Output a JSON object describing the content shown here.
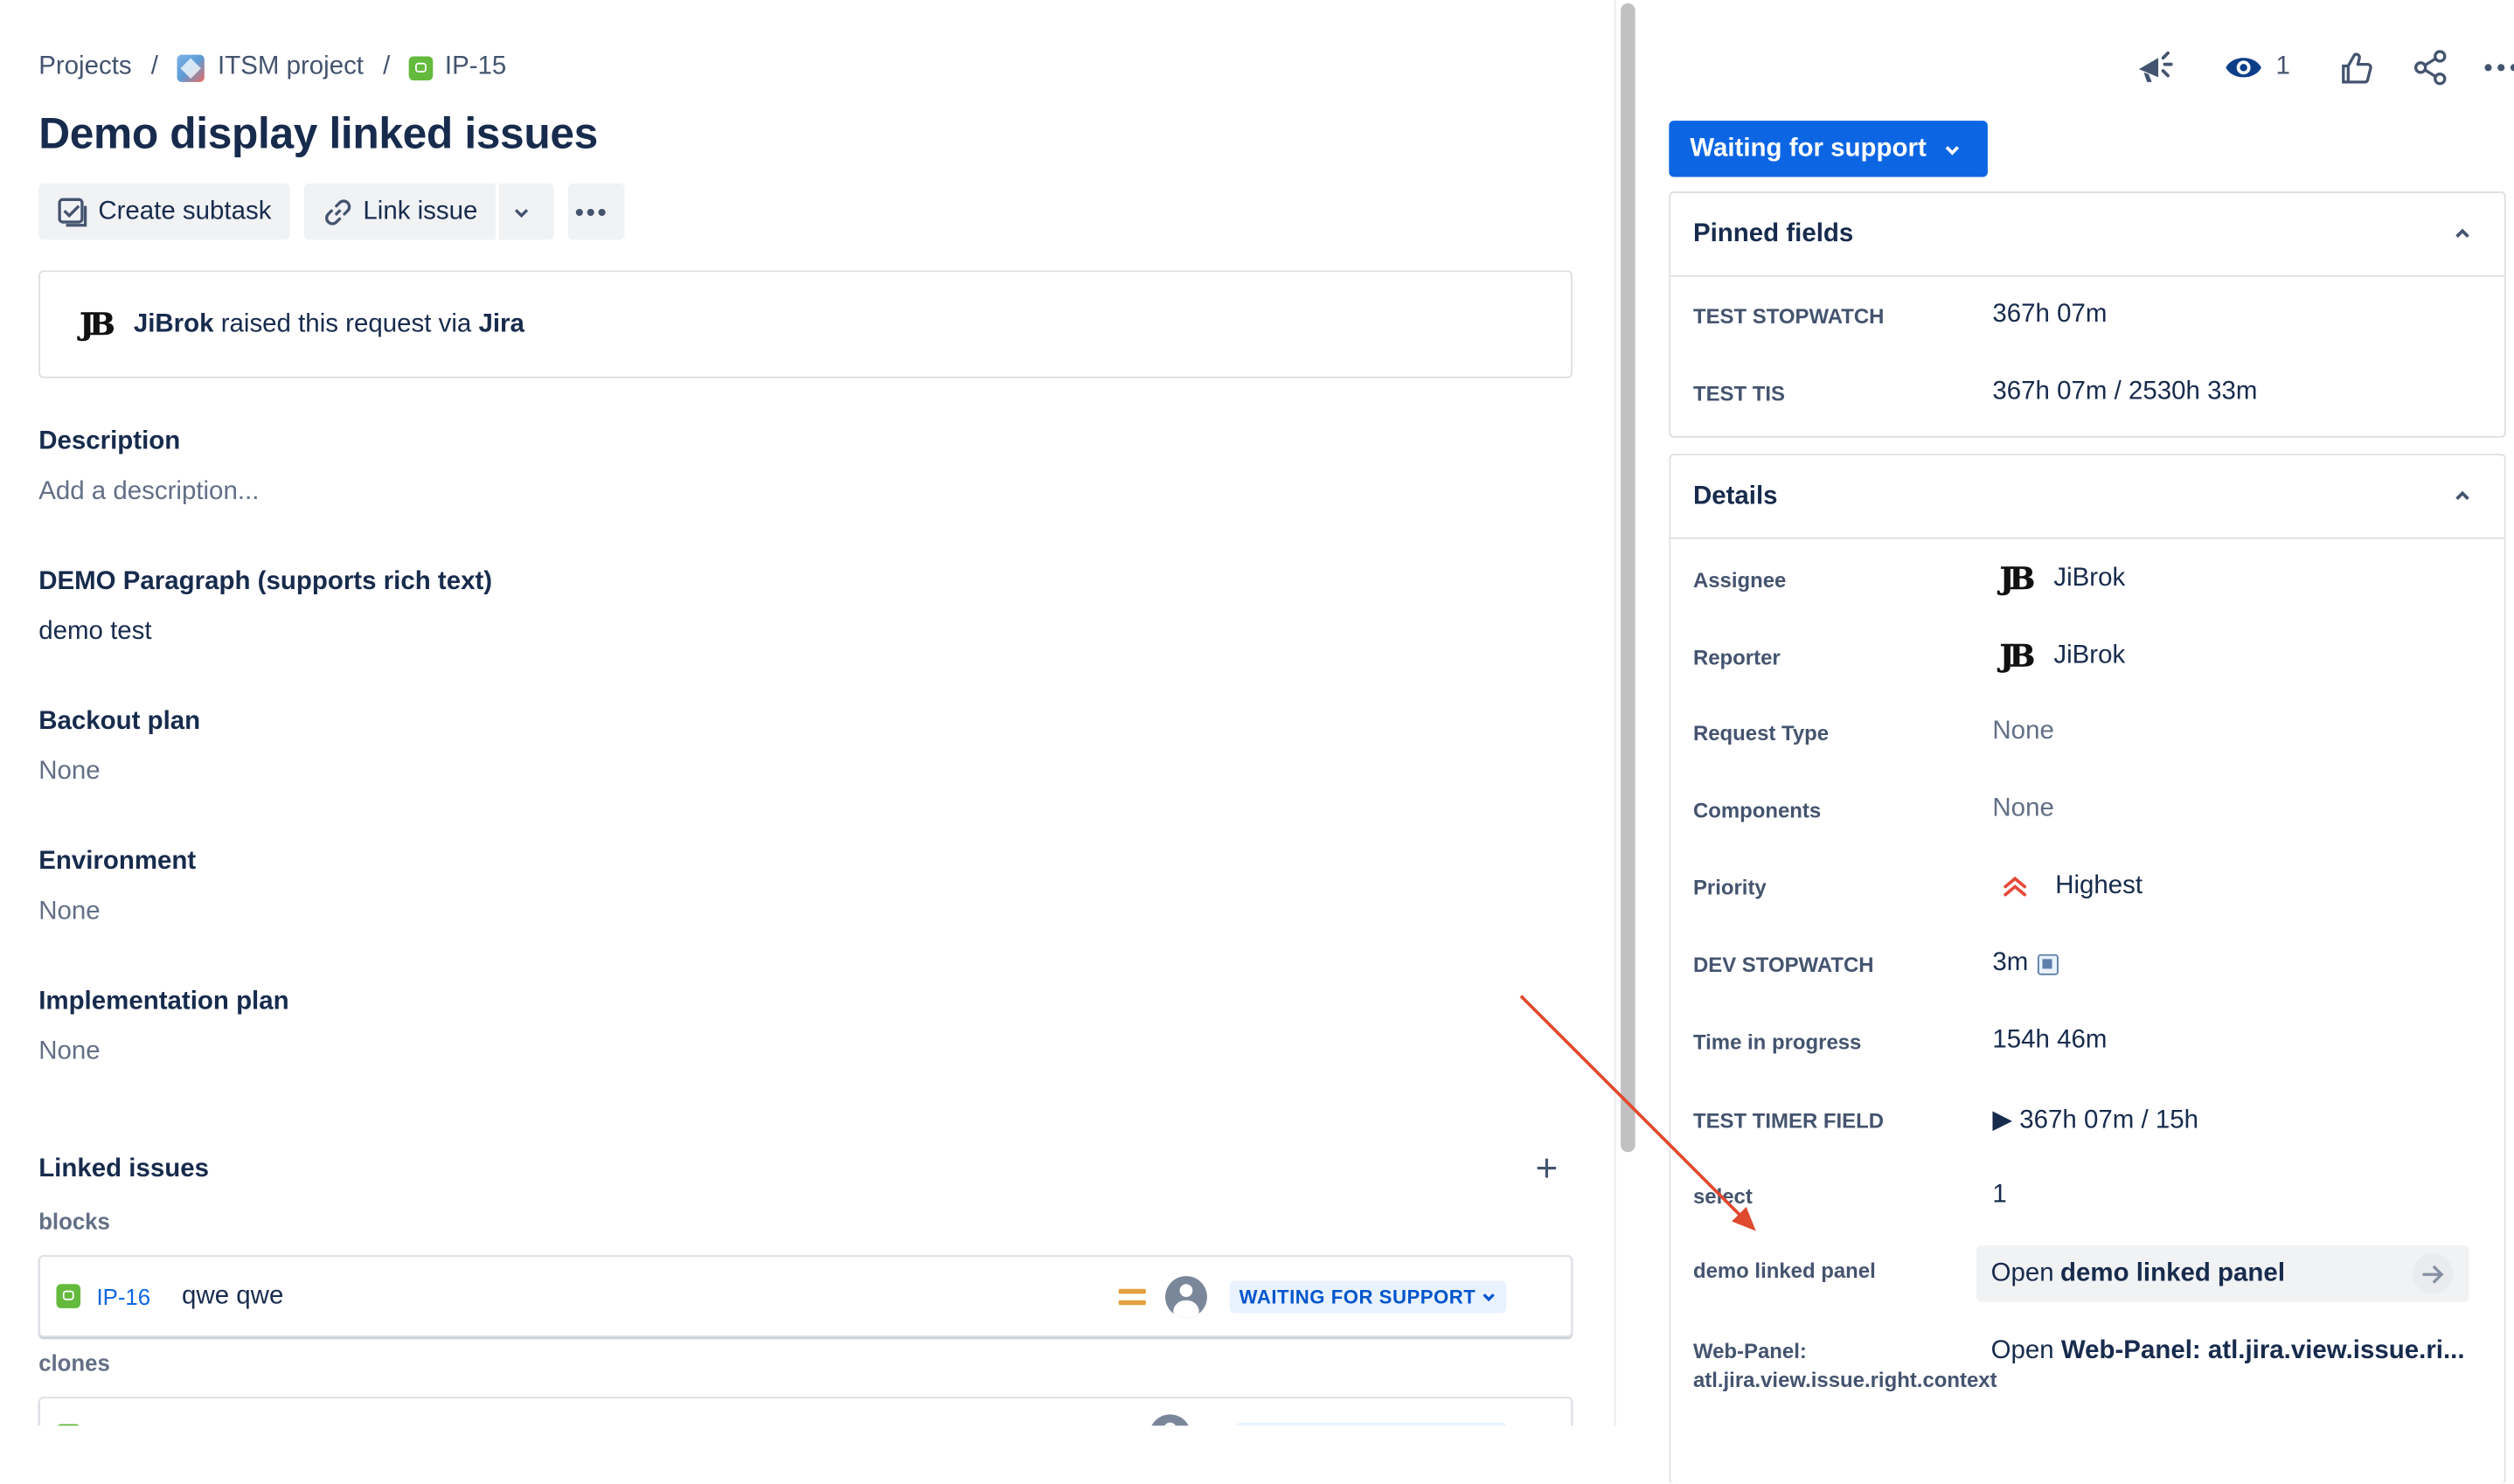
{
  "breadcrumb": {
    "projects": "Projects",
    "project": "ITSM project",
    "issue_key": "IP-15",
    "separator": "/"
  },
  "issue": {
    "title": "Demo display linked issues"
  },
  "toolbar": {
    "create_subtask": "Create subtask",
    "link_issue": "Link issue",
    "more_icon": "ellipsis-icon"
  },
  "request": {
    "user": "JiBrok",
    "text": "raised this request via",
    "channel": "Jira"
  },
  "fields": [
    {
      "label": "Description",
      "value": "Add a description..."
    },
    {
      "label": "DEMO Paragraph (supports rich text)",
      "value": "demo test"
    },
    {
      "label": "Backout plan",
      "value": "None"
    },
    {
      "label": "Environment",
      "value": "None"
    },
    {
      "label": "Implementation plan",
      "value": "None"
    }
  ],
  "linked": {
    "heading": "Linked issues",
    "groups": [
      {
        "relation": "blocks",
        "key": "IP-16",
        "summary": "qwe qwe",
        "status": "WAITING FOR SUPPORT"
      },
      {
        "relation": "clones"
      }
    ]
  },
  "top_actions": {
    "watch_count": "1",
    "icons": [
      "megaphone-icon",
      "eye-icon",
      "thumbs-up-icon",
      "share-icon",
      "more-icon"
    ]
  },
  "status_button": "Waiting for support",
  "pinned": {
    "title": "Pinned fields",
    "rows": [
      {
        "label": "TEST STOPWATCH",
        "value": "367h 07m"
      },
      {
        "label": "TEST TIS",
        "value": "367h 07m / 2530h 33m"
      }
    ]
  },
  "details": {
    "title": "Details",
    "assignee_label": "Assignee",
    "assignee": "JiBrok",
    "reporter_label": "Reporter",
    "reporter": "JiBrok",
    "request_type_label": "Request Type",
    "request_type": "None",
    "components_label": "Components",
    "components": "None",
    "priority_label": "Priority",
    "priority": "Highest",
    "dev_stopwatch_label": "DEV STOPWATCH",
    "dev_stopwatch": "3m",
    "time_in_progress_label": "Time in progress",
    "time_in_progress": "154h 46m",
    "test_timer_label": "TEST TIMER FIELD",
    "test_timer": "▶ 367h 07m / 15h",
    "select_label": "select",
    "select": "1",
    "demo_panel_label": "demo linked panel",
    "demo_panel_open": "Open",
    "demo_panel_name": "demo linked panel",
    "web_panel_label": "Web-Panel: atl.jira.view.issue.right.context",
    "web_panel_open": "Open",
    "web_panel_name": "Web-Panel: atl.jira.view.issue.ri..."
  },
  "colors": {
    "brand_blue": "#0c66e4",
    "annotation_arrow": "#e04a2f",
    "story_green": "#63ba3c"
  }
}
